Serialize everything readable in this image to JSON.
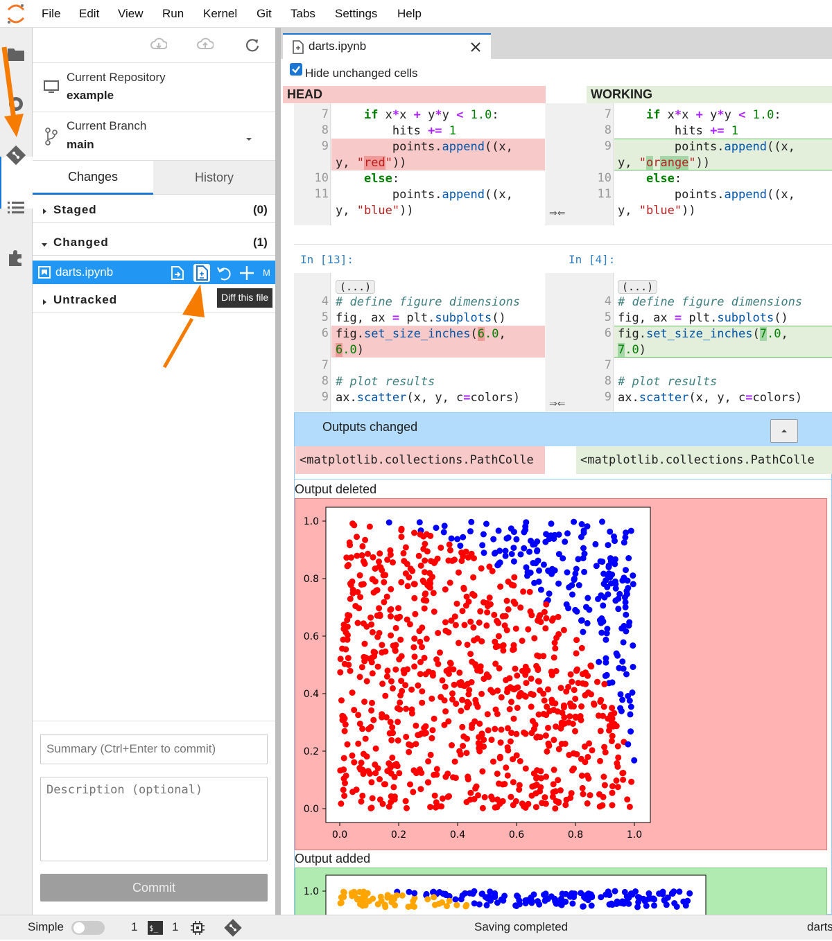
{
  "menubar": {
    "items": [
      "File",
      "Edit",
      "View",
      "Run",
      "Kernel",
      "Git",
      "Tabs",
      "Settings",
      "Help"
    ]
  },
  "git_panel": {
    "repo_label": "Current Repository",
    "repo_name": "example",
    "branch_label": "Current Branch",
    "branch_name": "main",
    "tabs": [
      "Changes",
      "History"
    ],
    "sections": {
      "staged": {
        "label": "Staged",
        "count": "(0)"
      },
      "changed": {
        "label": "Changed",
        "count": "(1)"
      },
      "untracked": {
        "label": "Untracked"
      }
    },
    "changed_file": {
      "name": "darts.ipynb",
      "status": "M"
    },
    "tooltip": "Diff this file",
    "summary_placeholder": "Summary (Ctrl+Enter to commit)",
    "description_placeholder": "Description (optional)",
    "commit_label": "Commit"
  },
  "tab": {
    "title": "darts.ipynb"
  },
  "diff": {
    "hide_unchanged_label": "Hide unchanged cells",
    "head_label": "HEAD",
    "working_label": "WORKING",
    "cell1": {
      "line_numbers": [
        "7",
        "8",
        "9",
        "",
        "10",
        "11",
        ""
      ]
    },
    "cell2": {
      "head_prompt": "In [13]:",
      "working_prompt": "In [4]:",
      "collapsed": "(...)",
      "line_numbers": [
        "4",
        "5",
        "6",
        "",
        "7",
        "8",
        "9"
      ]
    },
    "merge_arrows": "⇒⇐",
    "outputs_changed": "Outputs changed",
    "output_text": "<matplotlib.collections.PathColle",
    "output_deleted": "Output deleted",
    "output_added": "Output added"
  },
  "chart_data": {
    "type": "scatter",
    "xlim": [
      0.0,
      1.0
    ],
    "ylim": [
      0.0,
      1.0
    ],
    "xticks": [
      "0.0",
      "0.2",
      "0.4",
      "0.6",
      "0.8",
      "1.0"
    ],
    "yticks": [
      "0.0",
      "0.2",
      "0.4",
      "0.6",
      "0.8",
      "1.0"
    ],
    "series": [
      {
        "color": "#ff0000",
        "region": "inside unit circle",
        "points": 900
      },
      {
        "color": "#0000ff",
        "region": "outside unit circle",
        "points": 250
      }
    ]
  },
  "statusbar": {
    "mode": "Simple",
    "kernels": "1",
    "terminals": "1",
    "status": "Saving completed",
    "file": "darts"
  }
}
